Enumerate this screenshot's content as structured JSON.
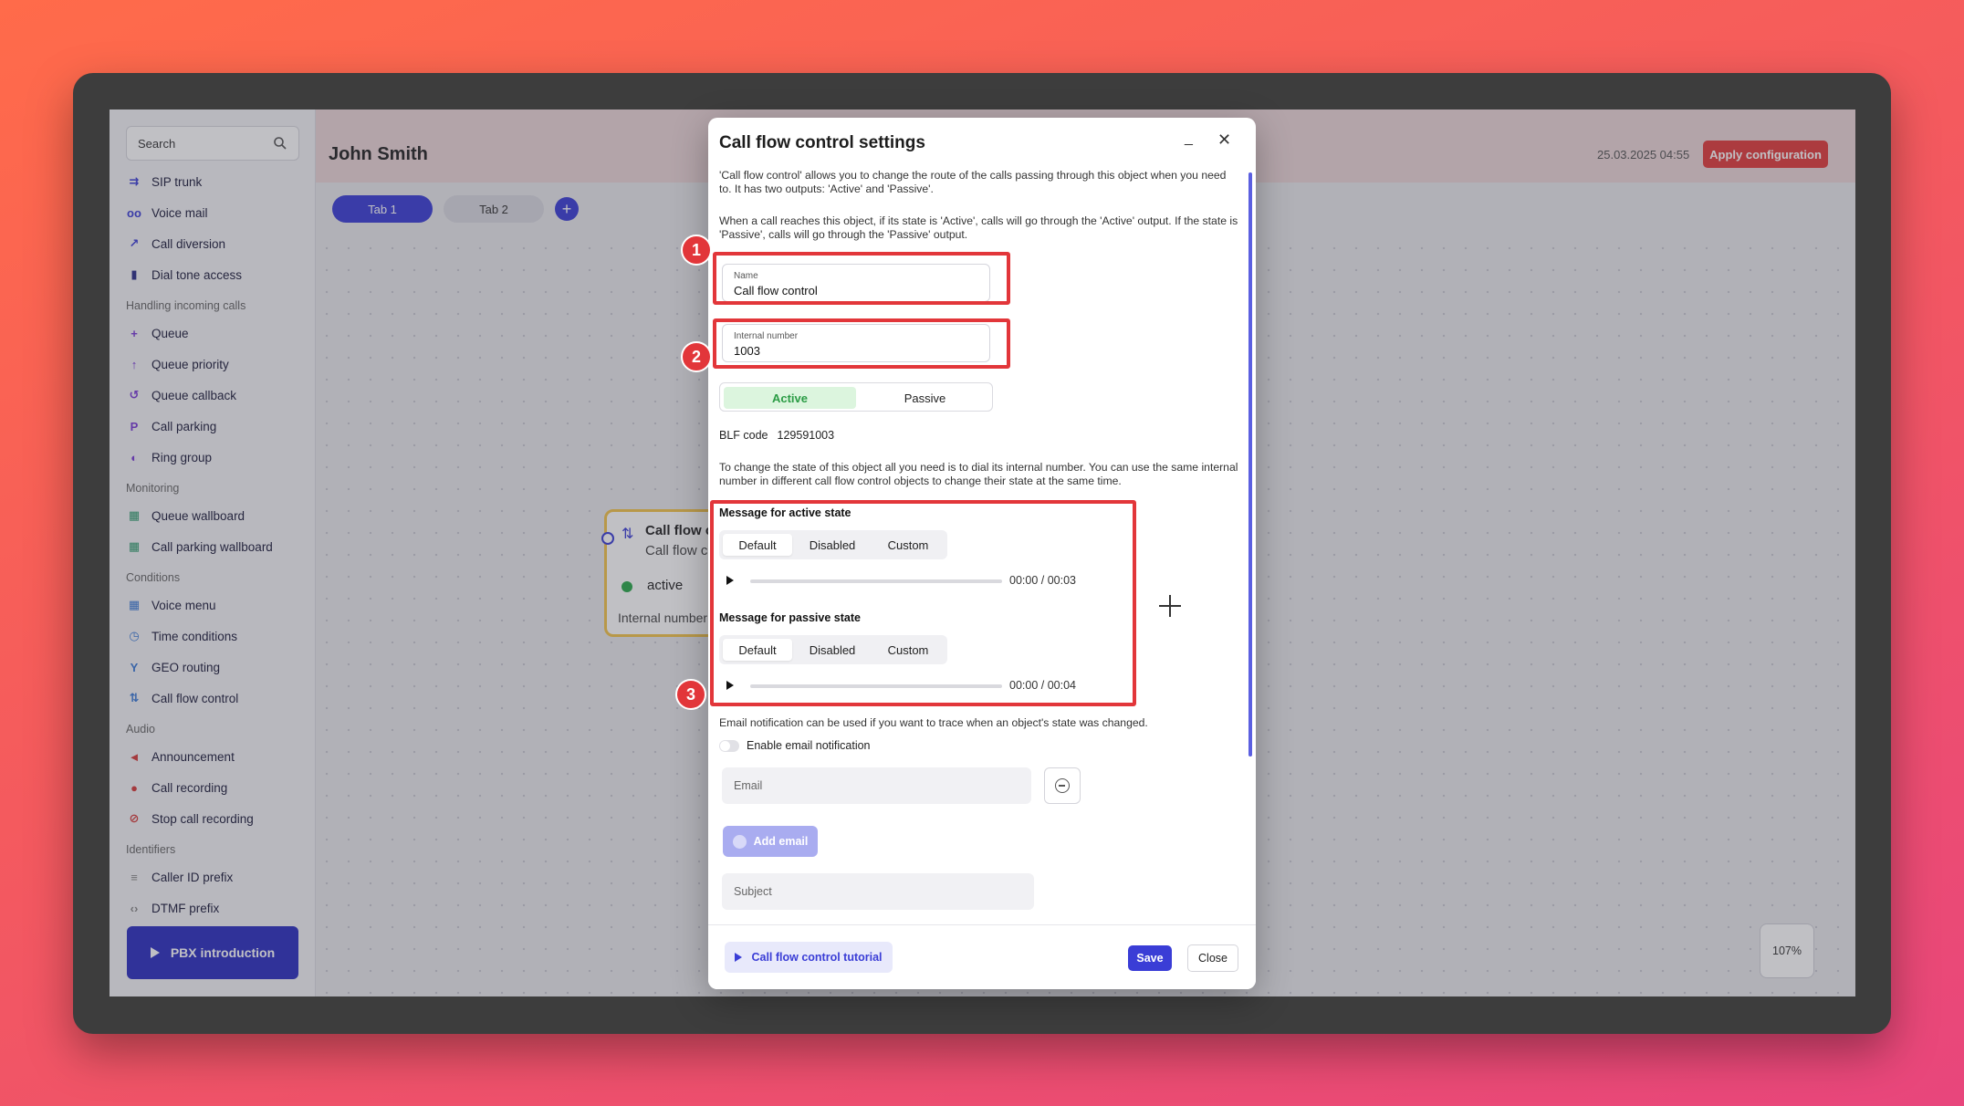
{
  "app": {
    "search_placeholder": "Search",
    "main_title": "John Smith",
    "tabs": [
      "Tab 1",
      "Tab 2"
    ],
    "datestamp": "25.03.2025 04:55",
    "apply_label": "Apply configuration",
    "zoom": "107%",
    "pbx_intro_label": "PBX introduction"
  },
  "sidebar": {
    "items": [
      {
        "label": "SIP trunk",
        "icon": "trunk-icon",
        "color": "#3a3dd6"
      },
      {
        "label": "Voice mail",
        "icon": "voicemail-icon",
        "color": "#3a3dd6"
      },
      {
        "label": "Call diversion",
        "icon": "diversion-icon",
        "color": "#3a3dd6"
      },
      {
        "label": "Dial tone access",
        "icon": "lock-icon",
        "color": "#2b2f8a"
      }
    ],
    "groups": [
      {
        "title": "Handling incoming calls",
        "items": [
          {
            "label": "Queue",
            "icon": "queue-icon",
            "color": "#7a3ad6"
          },
          {
            "label": "Queue priority",
            "icon": "arrow-up-icon",
            "color": "#7a3ad6"
          },
          {
            "label": "Queue callback",
            "icon": "callback-icon",
            "color": "#7a3ad6"
          },
          {
            "label": "Call parking",
            "icon": "parking-icon",
            "color": "#7a3ad6"
          },
          {
            "label": "Ring group",
            "icon": "group-icon",
            "color": "#7a3ad6"
          }
        ]
      },
      {
        "title": "Monitoring",
        "items": [
          {
            "label": "Queue wallboard",
            "icon": "wallboard-icon",
            "color": "#2a9a6a"
          },
          {
            "label": "Call parking wallboard",
            "icon": "wallboard-icon",
            "color": "#2a9a6a"
          }
        ]
      },
      {
        "title": "Conditions",
        "items": [
          {
            "label": "Voice menu",
            "icon": "menu-grid-icon",
            "color": "#3a7ad6"
          },
          {
            "label": "Time conditions",
            "icon": "clock-icon",
            "color": "#3a7ad6"
          },
          {
            "label": "GEO routing",
            "icon": "geo-icon",
            "color": "#3a7ad6"
          },
          {
            "label": "Call flow control",
            "icon": "flow-icon",
            "color": "#3a7ad6"
          }
        ]
      },
      {
        "title": "Audio",
        "items": [
          {
            "label": "Announcement",
            "icon": "megaphone-icon",
            "color": "#d63a3a"
          },
          {
            "label": "Call recording",
            "icon": "mic-icon",
            "color": "#d63a3a"
          },
          {
            "label": "Stop call recording",
            "icon": "mic-off-icon",
            "color": "#d63a3a"
          }
        ]
      },
      {
        "title": "Identifiers",
        "items": [
          {
            "label": "Caller ID prefix",
            "icon": "list-icon",
            "color": "#888888"
          },
          {
            "label": "DTMF prefix",
            "icon": "code-icon",
            "color": "#888888"
          }
        ]
      }
    ]
  },
  "node": {
    "title": "Call flow c",
    "subtitle": "Call flow c",
    "state": "active",
    "internal_label": "Internal number"
  },
  "dialog": {
    "title": "Call flow control settings",
    "minimize": "_",
    "close": "✕",
    "intro_1": "'Call flow control' allows you to change the route of the calls passing through this object when you need to. It has two outputs: 'Active' and 'Passive'.",
    "intro_2": "When a call reaches this object, if its state is 'Active', calls will go through the 'Active' output. If the state is 'Passive', calls will go through the 'Passive' output.",
    "name_label": "Name",
    "name_value": "Call flow control",
    "internal_label": "Internal number",
    "internal_value": "1003",
    "state_active": "Active",
    "state_passive": "Passive",
    "blf_label": "BLF code",
    "blf_value": "129591003",
    "change_state_text": "To change the state of this object all you need is to dial its internal number. You can use the same internal number in different call flow control objects to change their state at the same time.",
    "active_msg_title": "Message for active state",
    "passive_msg_title": "Message for passive state",
    "msg_options": [
      "Default",
      "Disabled",
      "Custom"
    ],
    "active_time": "00:00 / 00:03",
    "passive_time": "00:00 / 00:04",
    "email_note": "Email notification can be used if you want to trace when an object's state was changed.",
    "enable_email": "Enable email notification",
    "email_placeholder": "Email",
    "add_email": "Add email",
    "subject_placeholder": "Subject",
    "tutorial": "Call flow control tutorial",
    "save": "Save",
    "close_btn": "Close"
  },
  "annotations": [
    "1",
    "2",
    "3"
  ],
  "colors": {
    "accent": "#3a3dd6",
    "highlight": "#e2363a",
    "active_green": "#2b9c45"
  }
}
